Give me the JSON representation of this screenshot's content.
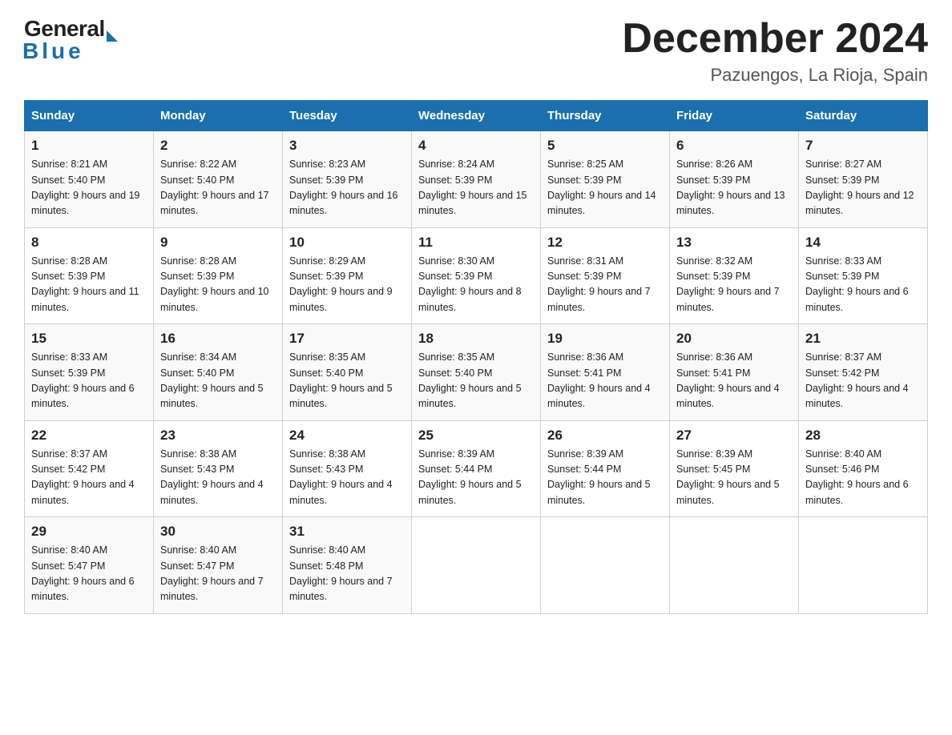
{
  "logo": {
    "general": "General",
    "blue": "Blue",
    "tagline": "Blue"
  },
  "header": {
    "month": "December 2024",
    "location": "Pazuengos, La Rioja, Spain"
  },
  "weekdays": [
    "Sunday",
    "Monday",
    "Tuesday",
    "Wednesday",
    "Thursday",
    "Friday",
    "Saturday"
  ],
  "weeks": [
    [
      {
        "day": "1",
        "sunrise": "8:21 AM",
        "sunset": "5:40 PM",
        "daylight": "9 hours and 19 minutes."
      },
      {
        "day": "2",
        "sunrise": "8:22 AM",
        "sunset": "5:40 PM",
        "daylight": "9 hours and 17 minutes."
      },
      {
        "day": "3",
        "sunrise": "8:23 AM",
        "sunset": "5:39 PM",
        "daylight": "9 hours and 16 minutes."
      },
      {
        "day": "4",
        "sunrise": "8:24 AM",
        "sunset": "5:39 PM",
        "daylight": "9 hours and 15 minutes."
      },
      {
        "day": "5",
        "sunrise": "8:25 AM",
        "sunset": "5:39 PM",
        "daylight": "9 hours and 14 minutes."
      },
      {
        "day": "6",
        "sunrise": "8:26 AM",
        "sunset": "5:39 PM",
        "daylight": "9 hours and 13 minutes."
      },
      {
        "day": "7",
        "sunrise": "8:27 AM",
        "sunset": "5:39 PM",
        "daylight": "9 hours and 12 minutes."
      }
    ],
    [
      {
        "day": "8",
        "sunrise": "8:28 AM",
        "sunset": "5:39 PM",
        "daylight": "9 hours and 11 minutes."
      },
      {
        "day": "9",
        "sunrise": "8:28 AM",
        "sunset": "5:39 PM",
        "daylight": "9 hours and 10 minutes."
      },
      {
        "day": "10",
        "sunrise": "8:29 AM",
        "sunset": "5:39 PM",
        "daylight": "9 hours and 9 minutes."
      },
      {
        "day": "11",
        "sunrise": "8:30 AM",
        "sunset": "5:39 PM",
        "daylight": "9 hours and 8 minutes."
      },
      {
        "day": "12",
        "sunrise": "8:31 AM",
        "sunset": "5:39 PM",
        "daylight": "9 hours and 7 minutes."
      },
      {
        "day": "13",
        "sunrise": "8:32 AM",
        "sunset": "5:39 PM",
        "daylight": "9 hours and 7 minutes."
      },
      {
        "day": "14",
        "sunrise": "8:33 AM",
        "sunset": "5:39 PM",
        "daylight": "9 hours and 6 minutes."
      }
    ],
    [
      {
        "day": "15",
        "sunrise": "8:33 AM",
        "sunset": "5:39 PM",
        "daylight": "9 hours and 6 minutes."
      },
      {
        "day": "16",
        "sunrise": "8:34 AM",
        "sunset": "5:40 PM",
        "daylight": "9 hours and 5 minutes."
      },
      {
        "day": "17",
        "sunrise": "8:35 AM",
        "sunset": "5:40 PM",
        "daylight": "9 hours and 5 minutes."
      },
      {
        "day": "18",
        "sunrise": "8:35 AM",
        "sunset": "5:40 PM",
        "daylight": "9 hours and 5 minutes."
      },
      {
        "day": "19",
        "sunrise": "8:36 AM",
        "sunset": "5:41 PM",
        "daylight": "9 hours and 4 minutes."
      },
      {
        "day": "20",
        "sunrise": "8:36 AM",
        "sunset": "5:41 PM",
        "daylight": "9 hours and 4 minutes."
      },
      {
        "day": "21",
        "sunrise": "8:37 AM",
        "sunset": "5:42 PM",
        "daylight": "9 hours and 4 minutes."
      }
    ],
    [
      {
        "day": "22",
        "sunrise": "8:37 AM",
        "sunset": "5:42 PM",
        "daylight": "9 hours and 4 minutes."
      },
      {
        "day": "23",
        "sunrise": "8:38 AM",
        "sunset": "5:43 PM",
        "daylight": "9 hours and 4 minutes."
      },
      {
        "day": "24",
        "sunrise": "8:38 AM",
        "sunset": "5:43 PM",
        "daylight": "9 hours and 4 minutes."
      },
      {
        "day": "25",
        "sunrise": "8:39 AM",
        "sunset": "5:44 PM",
        "daylight": "9 hours and 5 minutes."
      },
      {
        "day": "26",
        "sunrise": "8:39 AM",
        "sunset": "5:44 PM",
        "daylight": "9 hours and 5 minutes."
      },
      {
        "day": "27",
        "sunrise": "8:39 AM",
        "sunset": "5:45 PM",
        "daylight": "9 hours and 5 minutes."
      },
      {
        "day": "28",
        "sunrise": "8:40 AM",
        "sunset": "5:46 PM",
        "daylight": "9 hours and 6 minutes."
      }
    ],
    [
      {
        "day": "29",
        "sunrise": "8:40 AM",
        "sunset": "5:47 PM",
        "daylight": "9 hours and 6 minutes."
      },
      {
        "day": "30",
        "sunrise": "8:40 AM",
        "sunset": "5:47 PM",
        "daylight": "9 hours and 7 minutes."
      },
      {
        "day": "31",
        "sunrise": "8:40 AM",
        "sunset": "5:48 PM",
        "daylight": "9 hours and 7 minutes."
      },
      null,
      null,
      null,
      null
    ]
  ]
}
